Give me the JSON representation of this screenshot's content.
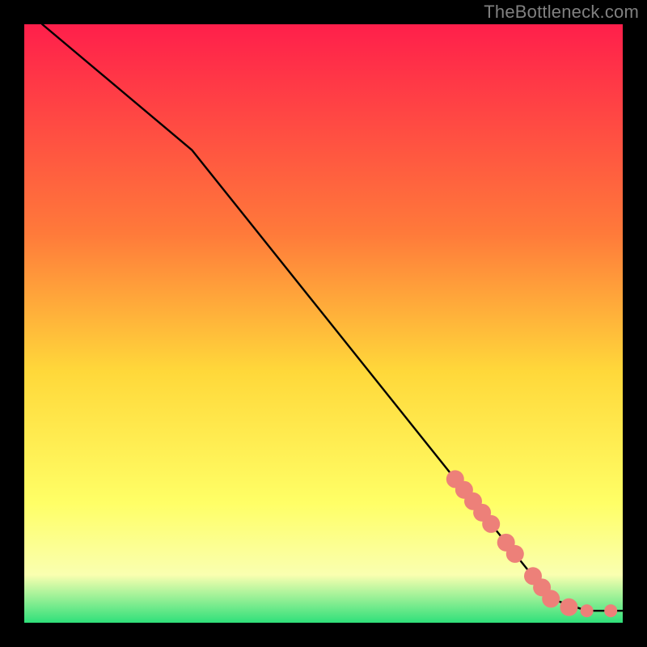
{
  "watermark": "TheBottleneck.com",
  "colors": {
    "gradient_top": "#ff1f4b",
    "gradient_mid1": "#ff7a3a",
    "gradient_mid2": "#ffd83a",
    "gradient_mid3": "#ffff66",
    "gradient_mid4": "#faffb0",
    "gradient_bottom": "#2fe07a",
    "line": "#000000",
    "marker": "#ed8079",
    "marker_stroke": "#8a4a46",
    "frame": "#000000"
  },
  "chart_data": {
    "type": "line",
    "title": "",
    "xlabel": "",
    "ylabel": "",
    "xlim": [
      0,
      100
    ],
    "ylim": [
      0,
      100
    ],
    "grid": false,
    "legend": false,
    "line_points": [
      {
        "x": 3,
        "y": 100
      },
      {
        "x": 28,
        "y": 79
      },
      {
        "x": 88,
        "y": 4
      },
      {
        "x": 94,
        "y": 2
      },
      {
        "x": 100,
        "y": 2
      }
    ],
    "markers": [
      {
        "x": 72.0,
        "y": 24.0
      },
      {
        "x": 73.5,
        "y": 22.2
      },
      {
        "x": 75.0,
        "y": 20.3
      },
      {
        "x": 76.5,
        "y": 18.4
      },
      {
        "x": 78.0,
        "y": 16.5
      },
      {
        "x": 80.5,
        "y": 13.4
      },
      {
        "x": 82.0,
        "y": 11.5
      },
      {
        "x": 85.0,
        "y": 7.8
      },
      {
        "x": 86.5,
        "y": 5.9
      },
      {
        "x": 88.0,
        "y": 4.0
      },
      {
        "x": 91.0,
        "y": 2.6
      },
      {
        "x": 94.0,
        "y": 2.0
      },
      {
        "x": 98.0,
        "y": 2.0
      }
    ],
    "marker_radius_big": 11,
    "marker_radius_small": 8
  }
}
